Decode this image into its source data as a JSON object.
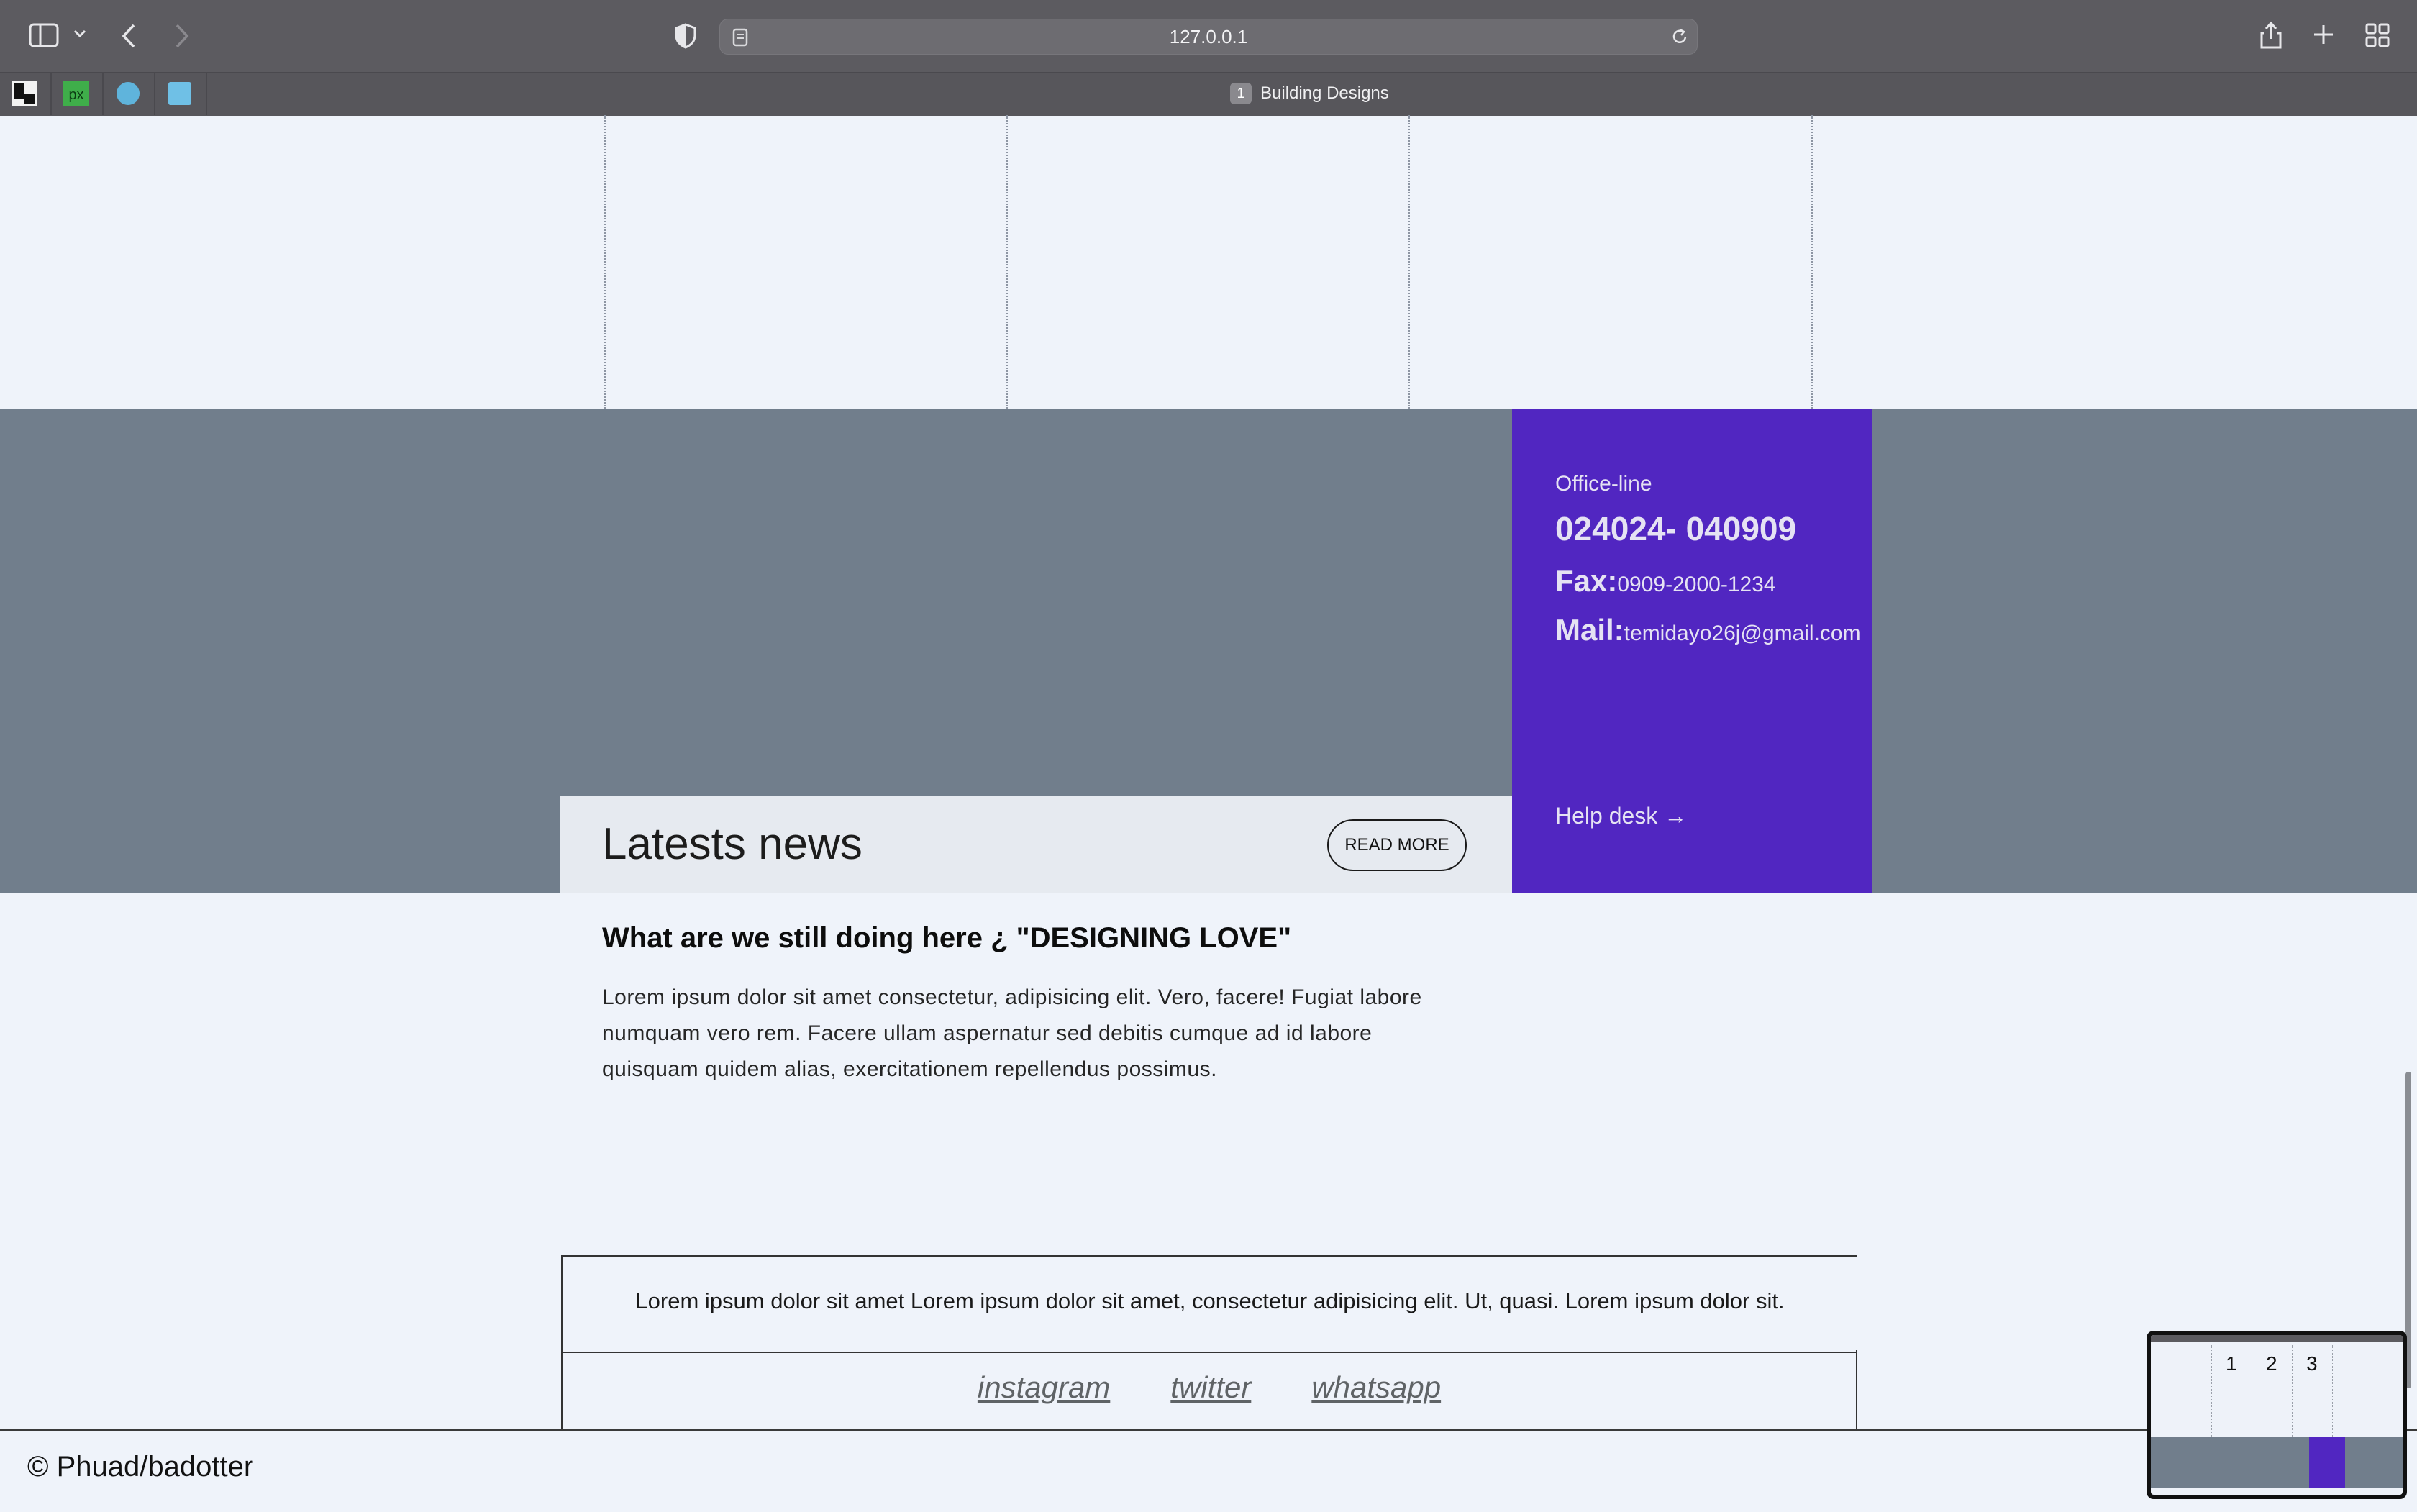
{
  "browser": {
    "url": "127.0.0.1",
    "tab_title": "Building Designs",
    "tab_badge": "1",
    "icons": [
      "sidebar-icon",
      "chevron-down-icon",
      "back-icon",
      "forward-icon",
      "shield-icon",
      "reader-icon",
      "reload-icon",
      "share-icon",
      "new-tab-icon",
      "tab-overview-icon"
    ],
    "extensions": [
      "checker-extension-icon",
      "pixel-extension-icon",
      "circle-extension-icon",
      "square-extension-icon"
    ]
  },
  "contact": {
    "office_line": "Office-line",
    "phone": "024024- 040909",
    "fax_label": "Fax:",
    "fax_value": "0909-2000-1234",
    "mail_label": "Mail:",
    "mail_value": "temidayo26j@gmail.com",
    "help_desk": "Help desk →"
  },
  "news": {
    "heading": "Latests news",
    "read_more": "READ MORE",
    "article_title": "What are we still doing here ¿ \"DESIGNING LOVE\"",
    "article_body": "Lorem ipsum dolor sit amet consectetur, adipisicing elit. Vero, facere! Fugiat labore numquam vero rem. Facere ullam aspernatur sed debitis cumque ad id labore quisquam quidem alias, exercitationem repellendus possimus."
  },
  "quote": {
    "text": "Lorem ipsum dolor sit amet Lorem ipsum dolor sit amet, consectetur adipisicing elit. Ut, quasi. Lorem ipsum dolor sit."
  },
  "social": {
    "links": [
      "instagram",
      "twitter",
      "whatsapp"
    ]
  },
  "footer": {
    "copyright": "© Phuad/badotter"
  },
  "minimap": {
    "numbers": [
      "1",
      "2",
      "3"
    ]
  },
  "colors": {
    "page_bg": "#eff3fa",
    "slate": "#717e8c",
    "purple": "#5126c1",
    "news_header_bg": "#e6eaf0"
  }
}
